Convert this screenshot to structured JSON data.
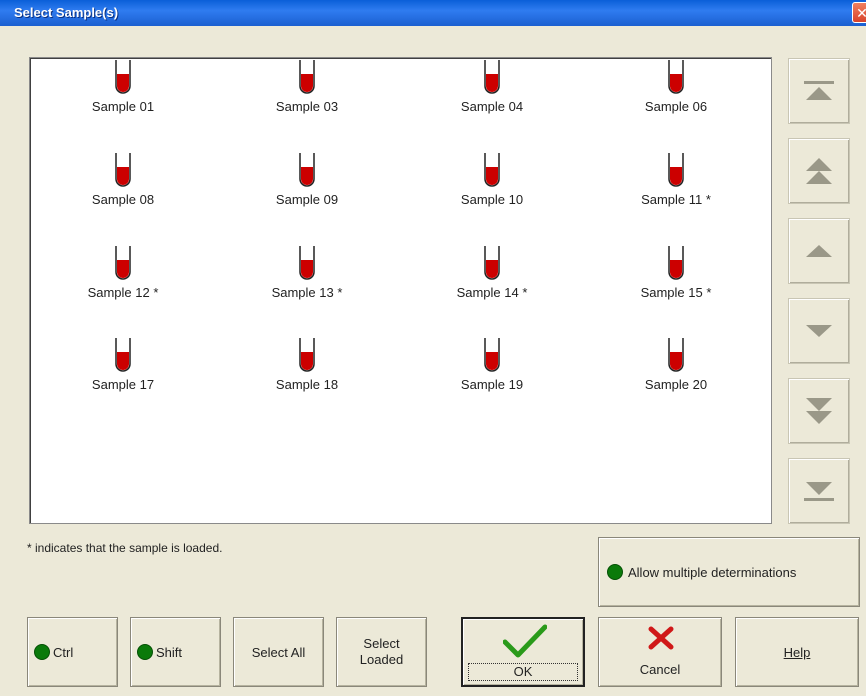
{
  "window": {
    "title": "Select Sample(s)",
    "close_glyph": "✕"
  },
  "samples": [
    {
      "label": "Sample 01"
    },
    {
      "label": "Sample 03"
    },
    {
      "label": "Sample 04"
    },
    {
      "label": "Sample 06"
    },
    {
      "label": "Sample 08"
    },
    {
      "label": "Sample 09"
    },
    {
      "label": "Sample 10"
    },
    {
      "label": "Sample 11 *"
    },
    {
      "label": "Sample 12 *"
    },
    {
      "label": "Sample 13 *"
    },
    {
      "label": "Sample 14 *"
    },
    {
      "label": "Sample 15 *"
    },
    {
      "label": "Sample 17"
    },
    {
      "label": "Sample 18"
    },
    {
      "label": "Sample 19"
    },
    {
      "label": "Sample 20"
    }
  ],
  "note": "* indicates that the sample is loaded.",
  "buttons": {
    "allow_multiple": "Allow multiple determinations",
    "ctrl": "Ctrl",
    "shift": "Shift",
    "select_all": "Select All",
    "select_loaded_line1": "Select",
    "select_loaded_line2": "Loaded",
    "ok": "OK",
    "cancel": "Cancel",
    "help": "Help"
  },
  "colors": {
    "tube": "#cc0000",
    "indicator": "#0a7a0a",
    "ok_check": "#2a9a1a",
    "cancel_x": "#d01818"
  }
}
